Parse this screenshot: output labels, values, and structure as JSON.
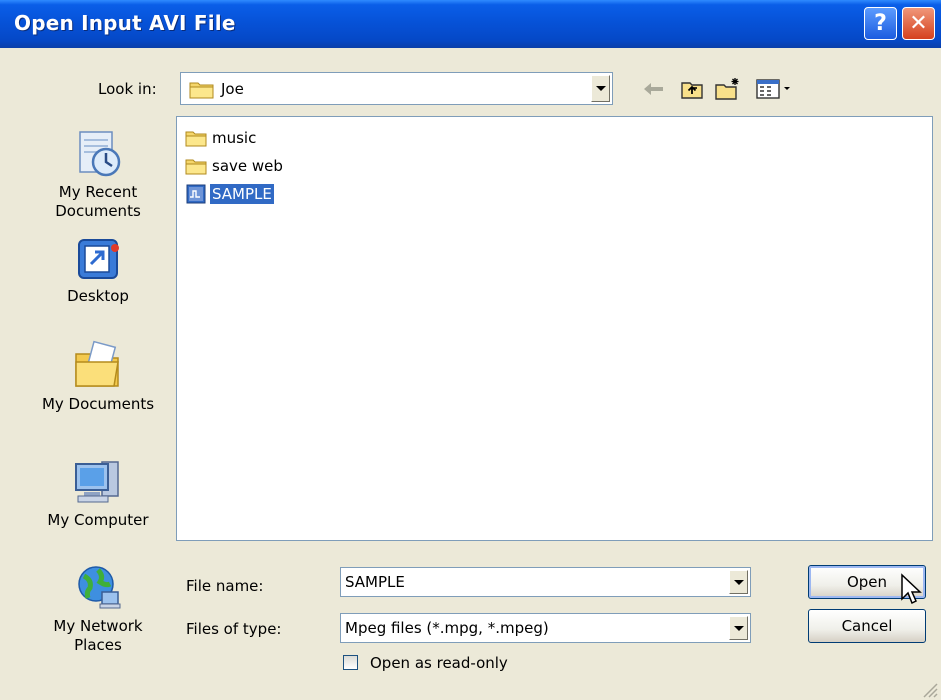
{
  "window": {
    "title": "Open Input AVI File"
  },
  "title_buttons": {
    "help": "?",
    "close": "✕"
  },
  "look_in": {
    "label": "Look in:",
    "value": "Joe"
  },
  "toolbar": {
    "back_icon": "back-arrow-icon",
    "up_icon": "up-folder-icon",
    "new_folder_icon": "new-folder-icon",
    "views_icon": "views-menu-icon"
  },
  "places": [
    {
      "label_line1": "My Recent",
      "label_line2": "Documents",
      "icon": "recent-documents-icon"
    },
    {
      "label_line1": "Desktop",
      "label_line2": "",
      "icon": "desktop-icon"
    },
    {
      "label_line1": "My Documents",
      "label_line2": "",
      "icon": "my-documents-icon"
    },
    {
      "label_line1": "My Computer",
      "label_line2": "",
      "icon": "my-computer-icon"
    },
    {
      "label_line1": "My Network",
      "label_line2": "Places",
      "icon": "network-places-icon"
    }
  ],
  "files": [
    {
      "name": "music",
      "type": "folder",
      "selected": false
    },
    {
      "name": "save web",
      "type": "folder",
      "selected": false
    },
    {
      "name": "SAMPLE",
      "type": "media",
      "selected": true
    }
  ],
  "file_name": {
    "label": "File name:",
    "value": "SAMPLE"
  },
  "file_type": {
    "label": "Files of type:",
    "value": "Mpeg files (*.mpg, *.mpeg)"
  },
  "buttons": {
    "open": "Open",
    "cancel": "Cancel"
  },
  "read_only": {
    "label": "Open as read-only",
    "checked": false
  },
  "colors": {
    "titlebar": "#0651D6",
    "selection": "#316AC5",
    "dialog_bg": "#ECE9D8",
    "border": "#7F9DB9"
  }
}
